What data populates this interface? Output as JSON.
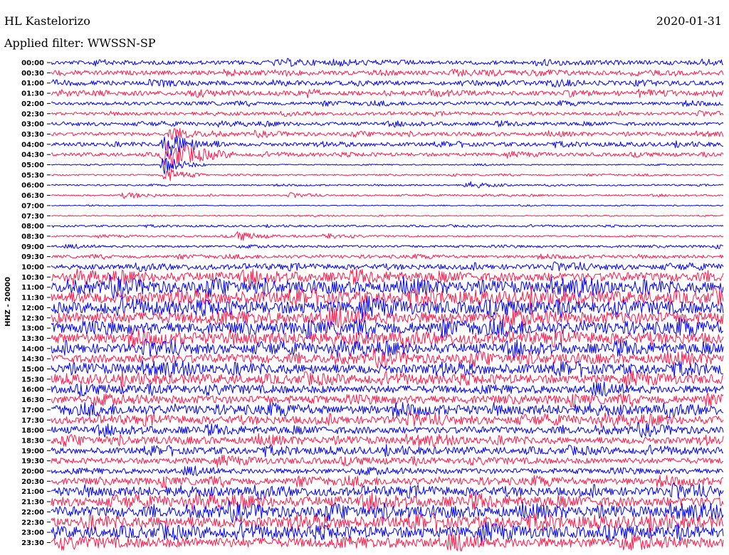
{
  "header": {
    "station": "HL Kastelorizo",
    "date": "2020-01-31",
    "filter": "Applied filter: WWSSN-SP"
  },
  "chart_data": {
    "type": "line",
    "ylabel": "HHZ - 20000",
    "row_labels": [
      "00:00",
      "00:30",
      "01:00",
      "01:30",
      "02:00",
      "02:30",
      "03:00",
      "03:30",
      "04:00",
      "04:30",
      "05:00",
      "05:30",
      "06:00",
      "06:30",
      "07:00",
      "07:30",
      "08:00",
      "08:30",
      "09:00",
      "09:30",
      "10:00",
      "10:30",
      "11:00",
      "11:30",
      "12:00",
      "12:30",
      "13:00",
      "13:30",
      "14:00",
      "14:30",
      "15:00",
      "15:30",
      "16:00",
      "16:30",
      "17:00",
      "17:30",
      "18:00",
      "18:30",
      "19:00",
      "19:30",
      "20:00",
      "20:30",
      "21:00",
      "21:30",
      "22:00",
      "22:30",
      "23:00",
      "23:30"
    ],
    "colors": [
      "#0000ff",
      "#ff1a4a"
    ],
    "relative_noise_amplitude": [
      1.2,
      1.3,
      1.2,
      1.3,
      1.0,
      0.9,
      1.0,
      1.0,
      1.1,
      1.0,
      0.35,
      0.45,
      0.4,
      0.45,
      0.25,
      0.3,
      0.5,
      0.5,
      0.7,
      0.9,
      1.5,
      2.6,
      3.2,
      3.4,
      3.6,
      3.6,
      3.4,
      3.2,
      2.8,
      2.6,
      2.8,
      2.6,
      2.4,
      2.4,
      2.6,
      2.3,
      2.0,
      2.0,
      1.9,
      1.8,
      1.6,
      2.0,
      2.5,
      2.8,
      3.0,
      3.2,
      3.2,
      3.0
    ],
    "events": [
      {
        "row": "03:30",
        "start_fraction": 0.17,
        "end_fraction": 0.26,
        "relative_amplitude": 3.0
      },
      {
        "row": "04:00",
        "start_fraction": 0.16,
        "end_fraction": 0.26,
        "relative_amplitude": 7.0
      },
      {
        "row": "04:30",
        "start_fraction": 0.16,
        "end_fraction": 0.27,
        "relative_amplitude": 9.0
      },
      {
        "row": "05:00",
        "start_fraction": 0.16,
        "end_fraction": 0.23,
        "relative_amplitude": 6.0
      },
      {
        "row": "05:30",
        "start_fraction": 0.16,
        "end_fraction": 0.23,
        "relative_amplitude": 5.0
      },
      {
        "row": "06:00",
        "start_fraction": 0.61,
        "end_fraction": 0.69,
        "relative_amplitude": 2.0
      },
      {
        "row": "06:30",
        "start_fraction": 0.1,
        "end_fraction": 0.19,
        "relative_amplitude": 1.8
      },
      {
        "row": "06:30",
        "start_fraction": 0.35,
        "end_fraction": 0.41,
        "relative_amplitude": 1.0
      },
      {
        "row": "08:30",
        "start_fraction": 0.27,
        "end_fraction": 0.34,
        "relative_amplitude": 3.0
      },
      {
        "row": "08:30",
        "start_fraction": 0.4,
        "end_fraction": 0.46,
        "relative_amplitude": 2.0
      }
    ]
  }
}
